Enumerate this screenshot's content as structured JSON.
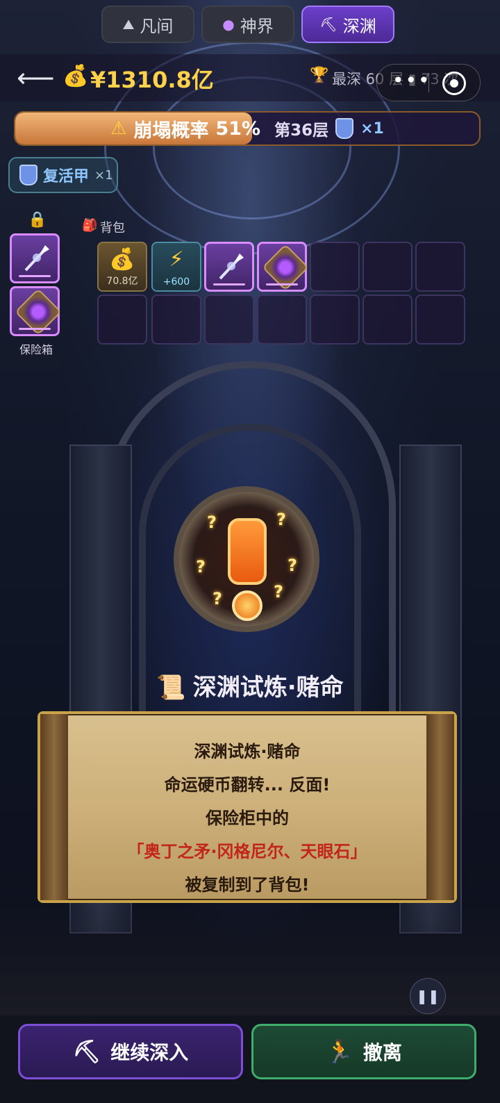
{
  "tabs": [
    {
      "label": "凡间",
      "icon": "mountain-icon"
    },
    {
      "label": "神界",
      "icon": "crystal-ball-icon"
    },
    {
      "label": "深渊",
      "icon": "pickaxe-icon"
    }
  ],
  "header": {
    "money": "¥1310.8亿",
    "deepest": "最深 60 层 ▮ 73 次"
  },
  "collapse_bar": {
    "percent": 51,
    "label": "崩塌概率",
    "percent_text": "51%",
    "layer": "第36层",
    "shield_count": "×1"
  },
  "revive": {
    "label": "复活甲",
    "count": "×1"
  },
  "safe": {
    "label": "保险箱",
    "items": [
      "spear",
      "eye-stone"
    ]
  },
  "bag": {
    "label": "背包",
    "items": [
      {
        "type": "money",
        "caption": "70.8亿"
      },
      {
        "type": "energy",
        "caption": "+600"
      },
      {
        "type": "spear",
        "caption": ""
      },
      {
        "type": "eye-stone",
        "caption": ""
      }
    ]
  },
  "event": {
    "title": "深渊试炼·赌命",
    "lines": [
      "深渊试炼·赌命",
      "命运硬币翻转... 反面!",
      "保险柜中的",
      "「奥丁之矛·冈格尼尔、天眼石」",
      "被复制到了背包!"
    ]
  },
  "buttons": {
    "continue": "继续深入",
    "retreat": "撤离"
  },
  "colors": {
    "accent": "#6c3fc9",
    "gold": "#ffd24a",
    "danger_text": "#c2261a",
    "retreat": "#3fae6c"
  }
}
